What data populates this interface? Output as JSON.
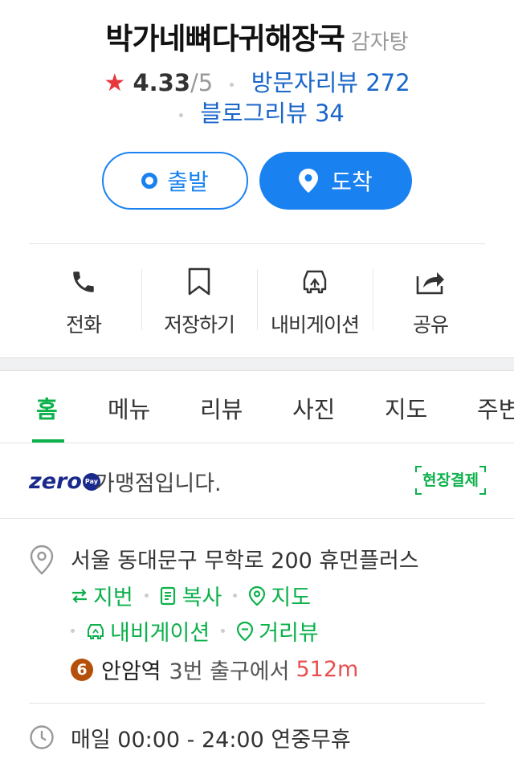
{
  "place": {
    "name": "박가네뼈다귀해장국",
    "category": "감자탕",
    "rating": "4.33",
    "rating_max": "/5",
    "visitor_reviews_label": "방문자리뷰",
    "visitor_reviews_count": "272",
    "blog_reviews_label": "블로그리뷰",
    "blog_reviews_count": "34"
  },
  "route_buttons": {
    "depart": "출발",
    "arrive": "도착"
  },
  "actions": [
    {
      "label": "전화",
      "icon": "phone-icon"
    },
    {
      "label": "저장하기",
      "icon": "bookmark-icon"
    },
    {
      "label": "내비게이션",
      "icon": "car-navigation-icon"
    },
    {
      "label": "공유",
      "icon": "share-icon"
    }
  ],
  "tabs": [
    {
      "label": "홈",
      "active": true
    },
    {
      "label": "메뉴",
      "active": false
    },
    {
      "label": "리뷰",
      "active": false
    },
    {
      "label": "사진",
      "active": false
    },
    {
      "label": "지도",
      "active": false
    },
    {
      "label": "주변",
      "active": false
    }
  ],
  "zeropay": {
    "logo": "zero",
    "logo_badge": "Pay",
    "text": "가맹점입니다.",
    "onsite_payment": "현장결제"
  },
  "address": {
    "text": "서울 동대문구 무학로 200 휴먼플러스",
    "links": [
      "지번",
      "복사",
      "지도",
      "내비게이션",
      "거리뷰"
    ],
    "subway_line": "6",
    "station": "안암역",
    "exit": "3번 출구에서",
    "distance": "512m"
  },
  "hours": {
    "text": "매일 00:00 - 24:00 연중무휴"
  },
  "colors": {
    "primary_blue": "#1a82f0",
    "green": "#0cb14b",
    "star_red": "#e8373c",
    "line6_brown": "#b5500b",
    "distance_red": "#e85050"
  }
}
